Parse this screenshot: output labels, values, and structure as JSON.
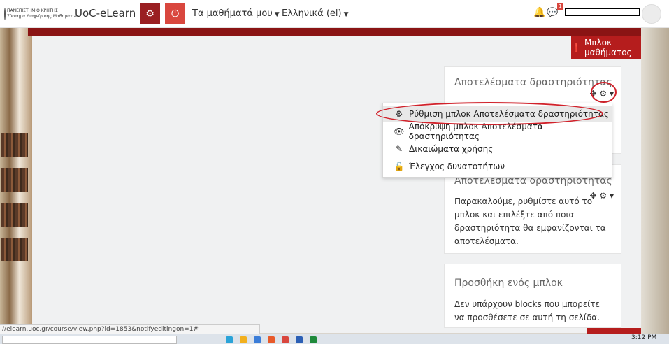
{
  "header": {
    "logo": {
      "line1": "ΠΑΝΕΠΙΣΤΗΜΙΟ ΚΡΗΤΗΣ",
      "line2": "Σύστημα Διαχείρισης Μαθημάτων"
    },
    "brand": "UoC-eLearn",
    "my_courses": "Τα μαθήματά μου",
    "language": "Ελληνικά (el)",
    "notification_count": "1"
  },
  "block_toggle": "Μπλοκ μαθήματος",
  "blocks": [
    {
      "title": "Αποτελέσματα δραστηριότητας"
    },
    {
      "title": "Αποτελέσματα δραστηριότητας",
      "body": "Παρακαλούμε, ρυθμίστε αυτό το μπλοκ και επιλέξτε από ποια δραστηριότητα θα εμφανίζονται τα αποτελέσματα."
    },
    {
      "title": "Προσθήκη ενός μπλοκ",
      "body": "Δεν υπάρχουν blocks που μπορείτε να προσθέσετε σε αυτή τη σελίδα."
    }
  ],
  "dropdown": [
    {
      "label": "Ρύθμιση μπλοκ Αποτελέσματα δραστηριότητας",
      "icon": "gear-icon"
    },
    {
      "label": "Απόκρυψη μπλοκ Αποτελέσματα δραστηριότητας",
      "icon": "eye-icon"
    },
    {
      "label": "Δικαιώματα χρήσης",
      "icon": "edit-icon"
    },
    {
      "label": "Έλεγχος δυνατοτήτων",
      "icon": "unlock-icon"
    }
  ],
  "status_url": "//elearn.uoc.gr/course/view.php?id=1853&notifyeditingon=1#",
  "clock": "3:12 PM",
  "colors": {
    "accent": "#c9292d",
    "dark_red": "#8a1414"
  }
}
